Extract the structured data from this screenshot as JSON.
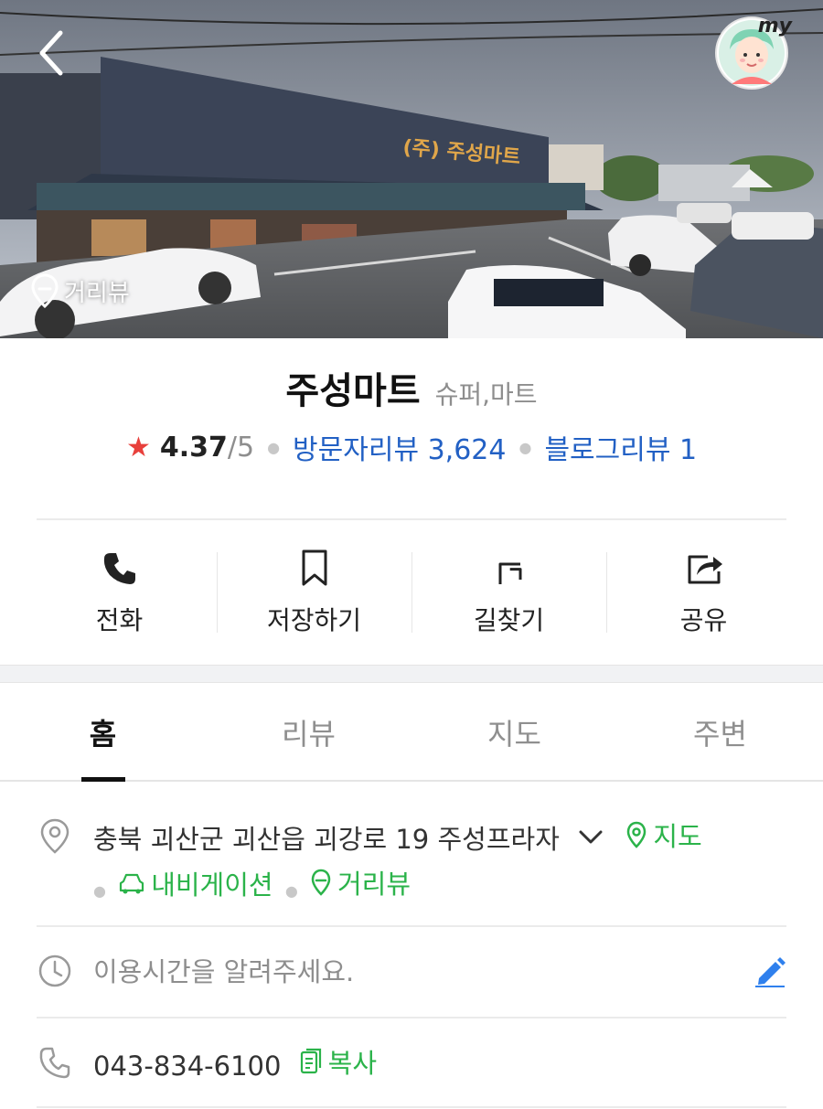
{
  "hero": {
    "streetview_label": "거리뷰",
    "sign_text": "(주) 주성마트",
    "avatar_badge": "my"
  },
  "place": {
    "name": "주성마트",
    "category": "슈퍼,마트",
    "rating": "4.37",
    "rating_max": "/5",
    "visitor_reviews": "방문자리뷰 3,624",
    "blog_reviews": "블로그리뷰 1"
  },
  "actions": [
    {
      "label": "전화",
      "icon": "phone-icon"
    },
    {
      "label": "저장하기",
      "icon": "bookmark-icon"
    },
    {
      "label": "길찾기",
      "icon": "directions-icon"
    },
    {
      "label": "공유",
      "icon": "share-icon"
    }
  ],
  "tabs": [
    {
      "label": "홈",
      "active": true
    },
    {
      "label": "리뷰",
      "active": false
    },
    {
      "label": "지도",
      "active": false
    },
    {
      "label": "주변",
      "active": false
    }
  ],
  "address": {
    "text": "충북 괴산군 괴산읍 괴강로 19 주성프라자",
    "map_link": "지도",
    "navigation_link": "내비게이션",
    "streetview_link": "거리뷰"
  },
  "hours": {
    "placeholder": "이용시간을 알려주세요."
  },
  "phone": {
    "number": "043-834-6100",
    "copy_label": "복사"
  },
  "colors": {
    "link_blue": "#2260c4",
    "accent_green": "#2bb34a",
    "star_red": "#e8403c"
  }
}
